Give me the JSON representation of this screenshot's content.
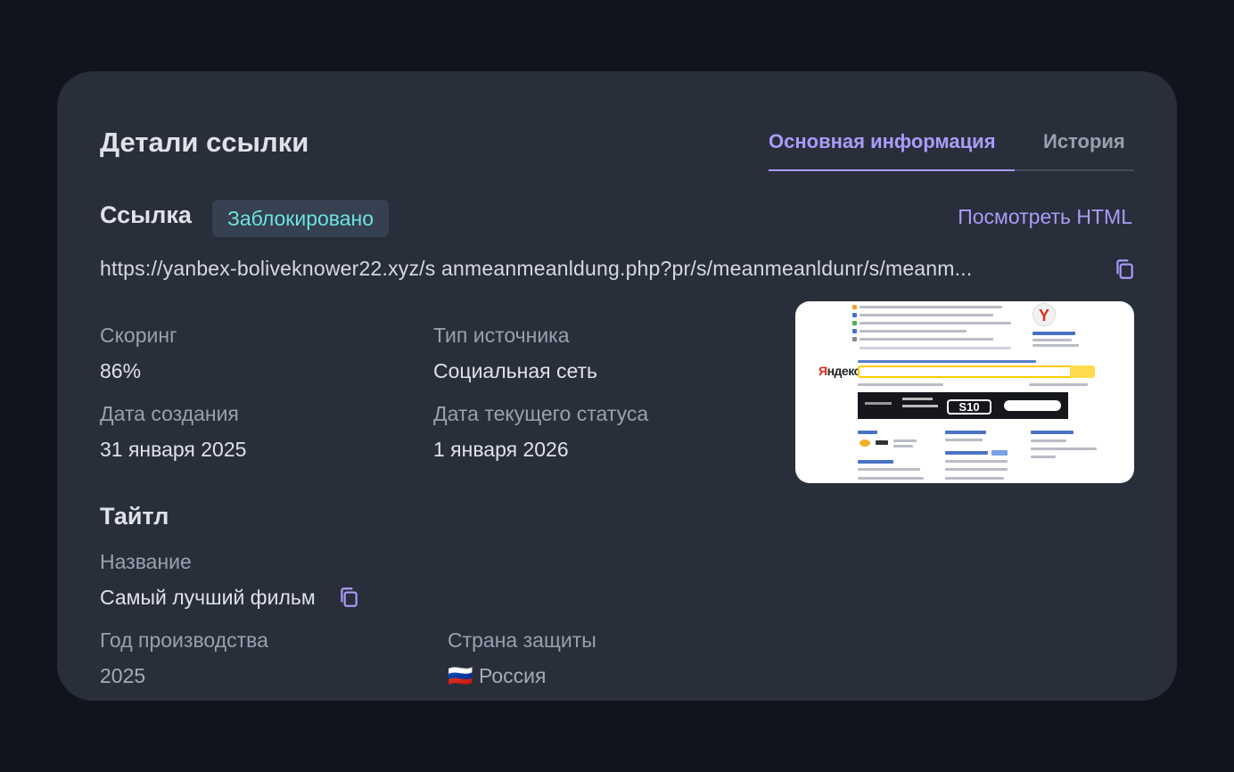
{
  "header": {
    "title": "Детали ссылки",
    "tabs": [
      {
        "label": "Основная информация",
        "active": true
      },
      {
        "label": "История",
        "active": false
      }
    ]
  },
  "link": {
    "section_title": "Ссылка",
    "status_badge": "Заблокировано",
    "view_html_label": "Посмотреть HTML",
    "url": "https://yanbex-boliveknower22.xyz/s anmeanmeanldung.php?pr/s/meanmeanldunr/s/meanm..."
  },
  "details": {
    "scoring_label": "Скоринг",
    "scoring_value": "86%",
    "source_type_label": "Тип источника",
    "source_type_value": "Социальная сеть",
    "created_label": "Дата создания",
    "created_value": "31 января 2025",
    "status_date_label": "Дата текущего статуса",
    "status_date_value": "1 января 2026"
  },
  "title_section": {
    "section_title": "Тайтл",
    "name_label": "Название",
    "name_value": "Самый лучший фильм",
    "year_label": "Год производства",
    "year_value": "2025",
    "country_label": "Страна защиты",
    "country_flag": "🇷🇺",
    "country_value": "Россия"
  },
  "preview": {
    "logo_text_start": "Я",
    "logo_text_rest": "ндекс",
    "banner_label": "S10"
  },
  "colors": {
    "accent": "#a99cf7",
    "badge_text": "#6ee3de",
    "card_bg": "#292e3b",
    "page_bg": "#11141c"
  }
}
